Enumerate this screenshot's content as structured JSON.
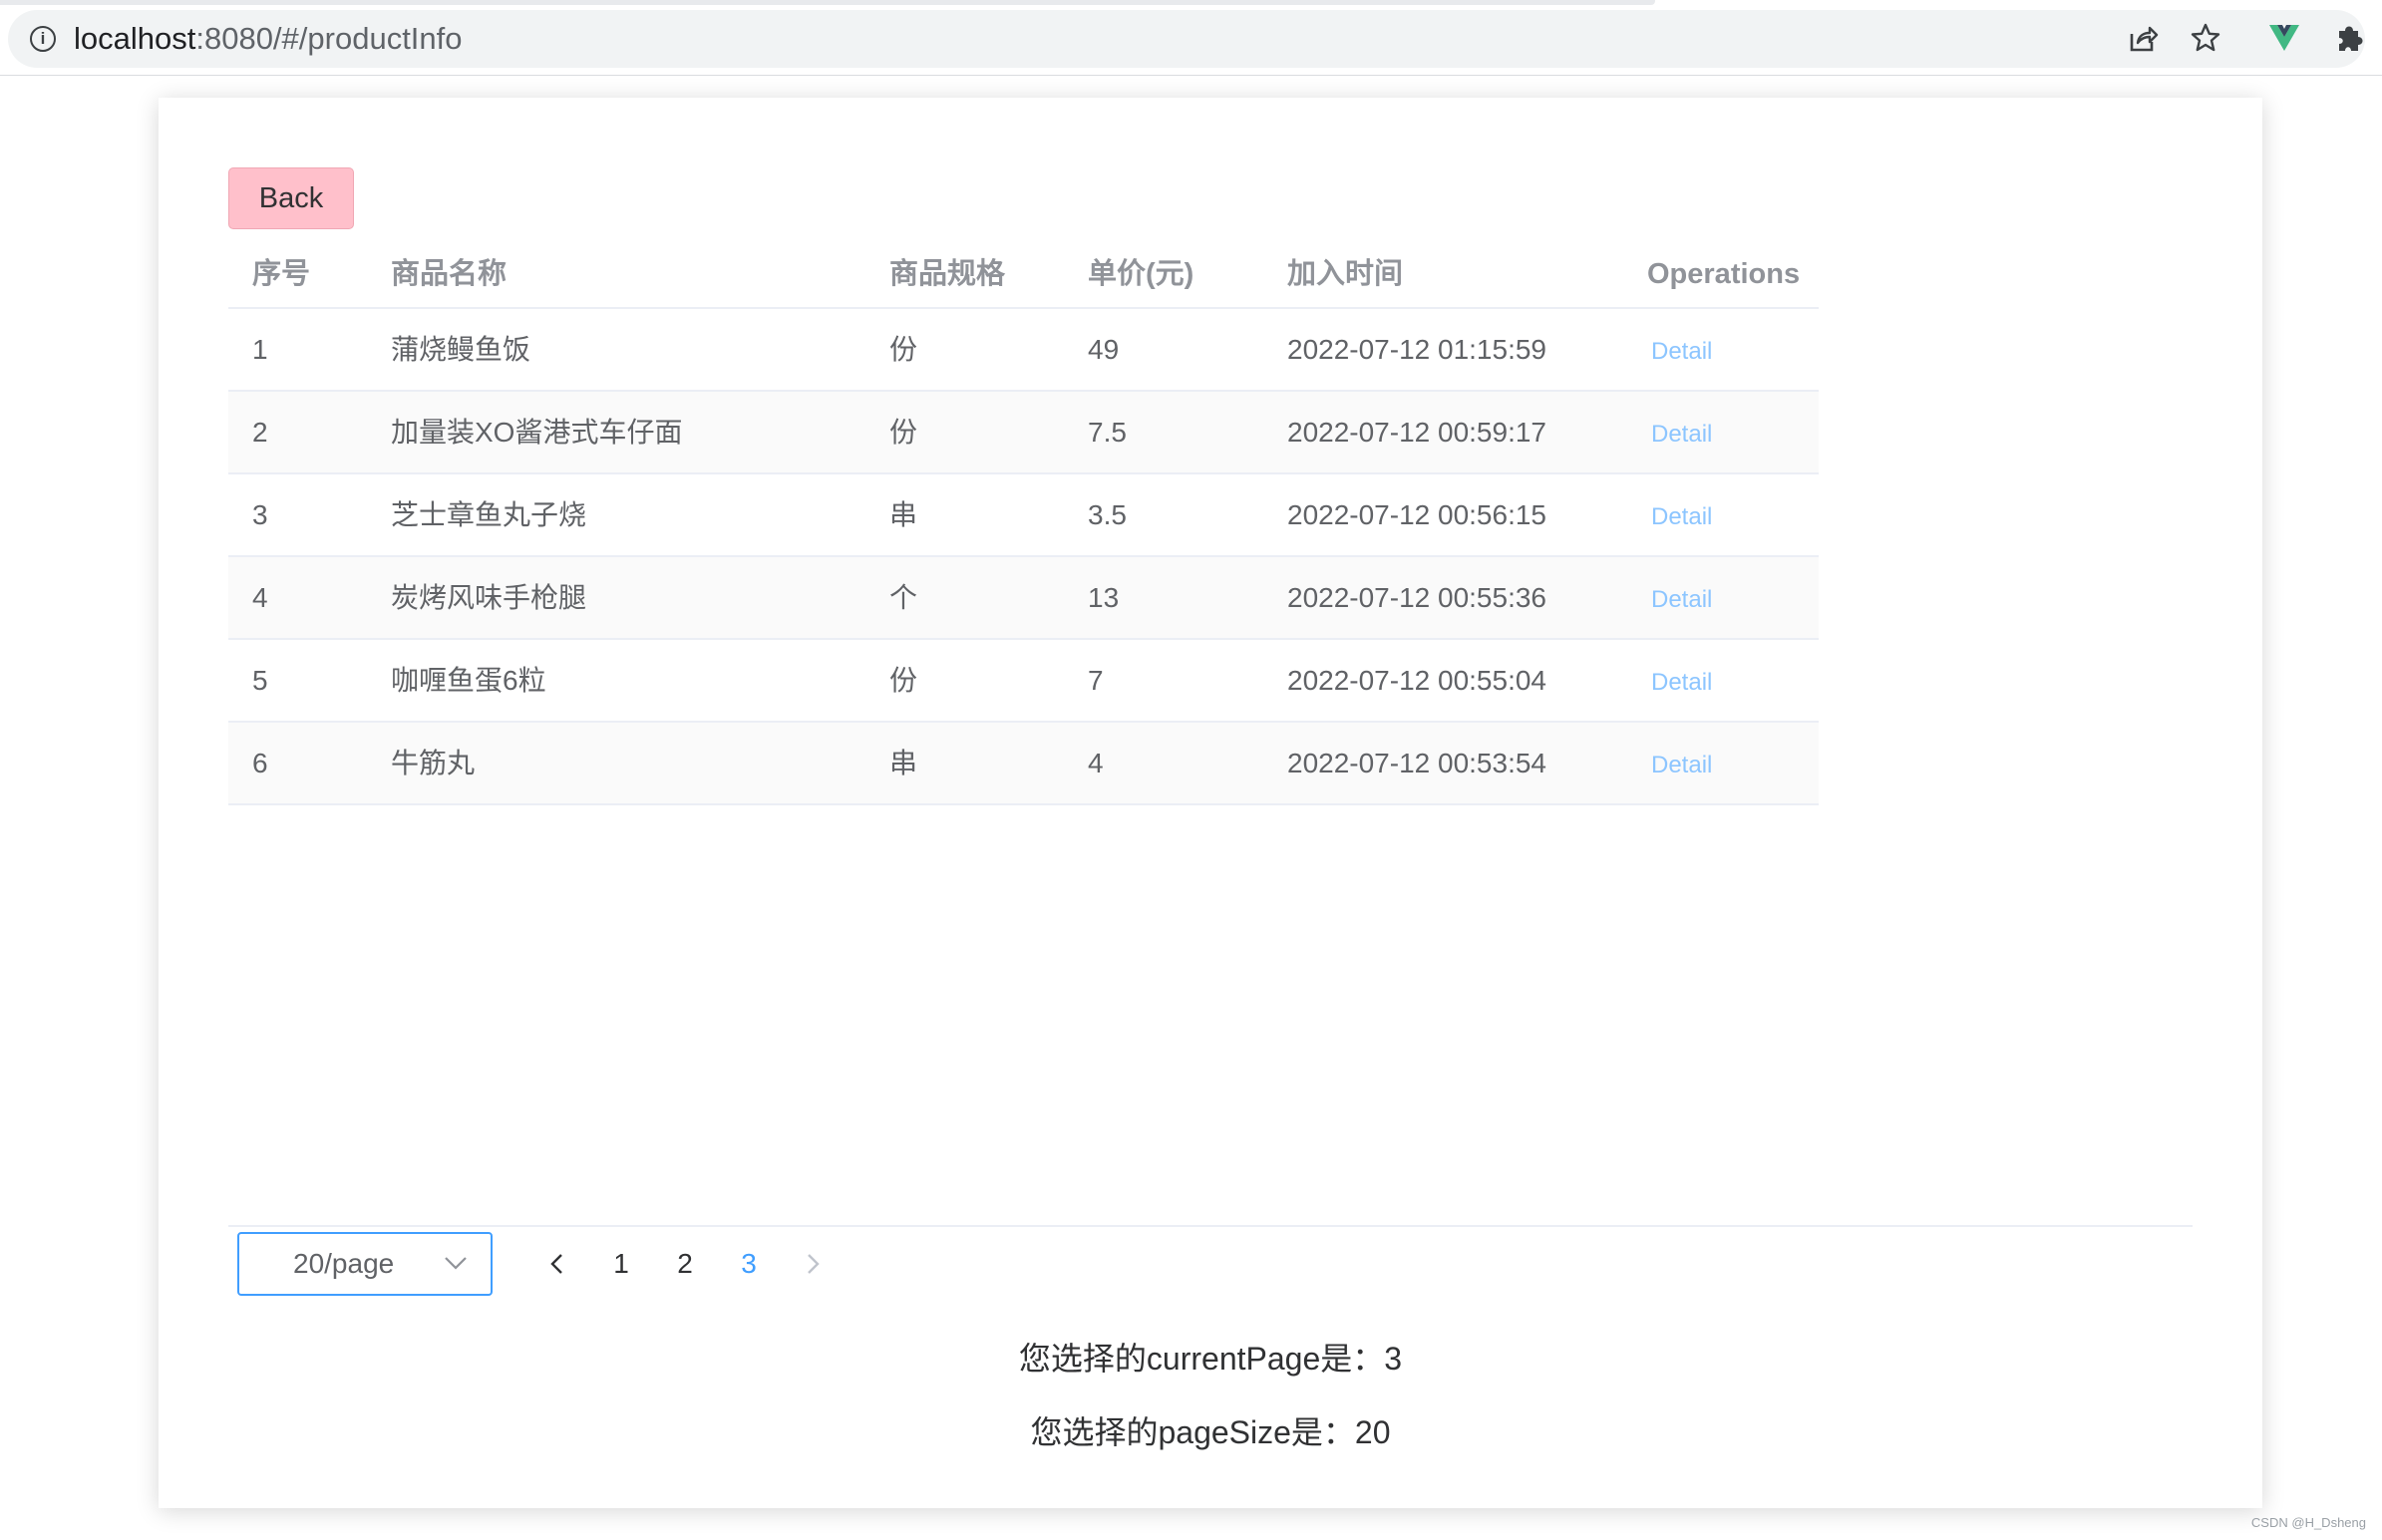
{
  "browser": {
    "url_host": "localhost",
    "url_rest": ":8080/#/productInfo"
  },
  "page": {
    "back_label": "Back",
    "table": {
      "headers": [
        "序号",
        "商品名称",
        "商品规格",
        "单价(元)",
        "加入时间",
        "Operations"
      ],
      "rows": [
        {
          "index": "1",
          "name": "蒲烧鳗鱼饭",
          "spec": "份",
          "price": "49",
          "time": "2022-07-12 01:15:59",
          "action": "Detail"
        },
        {
          "index": "2",
          "name": "加量装XO酱港式车仔面",
          "spec": "份",
          "price": "7.5",
          "time": "2022-07-12 00:59:17",
          "action": "Detail"
        },
        {
          "index": "3",
          "name": "芝士章鱼丸子烧",
          "spec": "串",
          "price": "3.5",
          "time": "2022-07-12 00:56:15",
          "action": "Detail"
        },
        {
          "index": "4",
          "name": "炭烤风味手枪腿",
          "spec": "个",
          "price": "13",
          "time": "2022-07-12 00:55:36",
          "action": "Detail"
        },
        {
          "index": "5",
          "name": "咖喱鱼蛋6粒",
          "spec": "份",
          "price": "7",
          "time": "2022-07-12 00:55:04",
          "action": "Detail"
        },
        {
          "index": "6",
          "name": "牛筋丸",
          "spec": "串",
          "price": "4",
          "time": "2022-07-12 00:53:54",
          "action": "Detail"
        }
      ]
    },
    "pagination": {
      "page_size_value": "20/page",
      "pages": [
        "1",
        "2",
        "3"
      ],
      "current_page": "3"
    },
    "current_page_text": "您选择的currentPage是：3",
    "page_size_text": "您选择的pageSize是：20"
  },
  "watermark": "CSDN @H_Dsheng",
  "colors": {
    "back_button": "#ffc0cb",
    "accent": "#409eff",
    "detail_link": "#8cc5ff",
    "vue_green": "#41b883",
    "vue_dark": "#35495e"
  },
  "icons": [
    "info-icon",
    "share-icon",
    "star-icon",
    "vue-devtools-icon",
    "extensions-icon",
    "chevron-down-icon",
    "chevron-left-icon",
    "chevron-right-icon"
  ]
}
